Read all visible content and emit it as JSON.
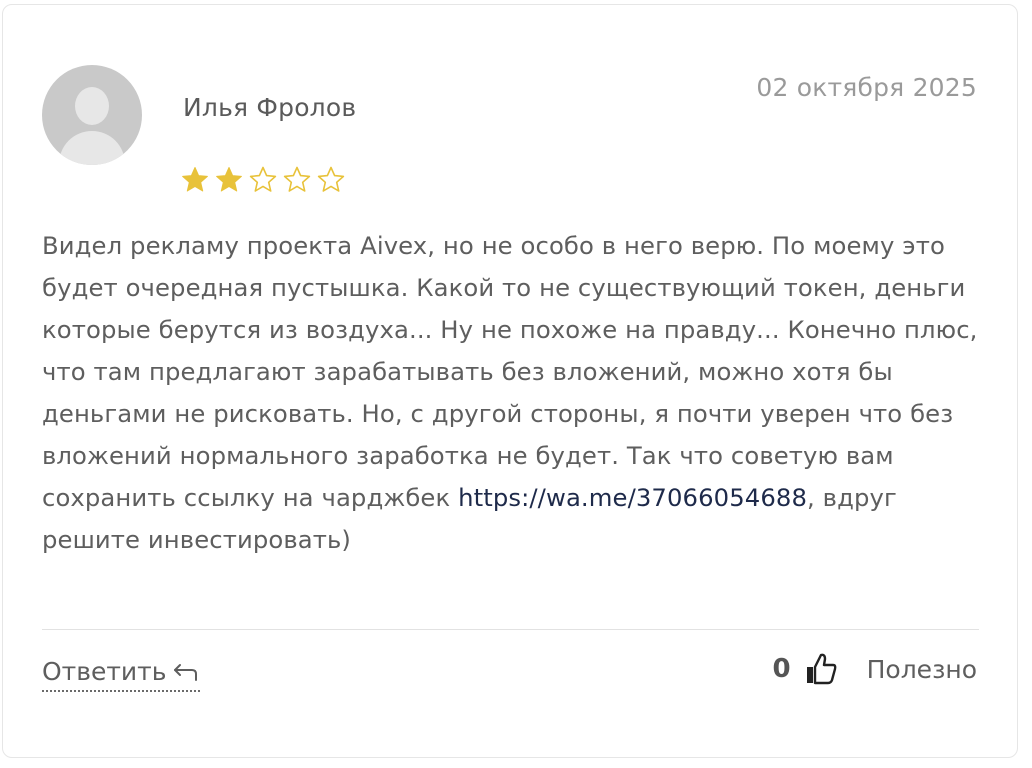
{
  "review": {
    "author": "Илья Фролов",
    "date": "02 октября 2025",
    "rating": 2,
    "rating_max": 5,
    "text_before_link": "Видел рекламу проекта Aivex, но не особо в него верю. По моему это будет очередная пустышка. Какой то не существующий токен, деньги которые берутся из воздуха... Ну не похоже на правду... Конечно плюс, что там предлагают зарабатывать без вложений, можно хотя бы деньгами не рисковать. Но, с другой стороны, я почти уверен что без вложений нормального заработка не будет. Так что советую вам сохранить ссылку на чарджбек ",
    "link_text": "https://wa.me/37066054688",
    "text_after_link": ", вдруг решите инвестировать)"
  },
  "actions": {
    "reply_label": "Ответить",
    "helpful_count": "0",
    "helpful_label": "Полезно"
  },
  "icons": {
    "avatar": "user-placeholder-icon",
    "star_filled": "star-filled-icon",
    "star_empty": "star-outline-icon",
    "reply": "reply-arrow-icon",
    "thumb": "thumbs-up-icon"
  },
  "colors": {
    "star": "#e8c23a",
    "link": "#1e2a4a",
    "date": "#9a9a9a",
    "text": "#5e5e5e"
  }
}
